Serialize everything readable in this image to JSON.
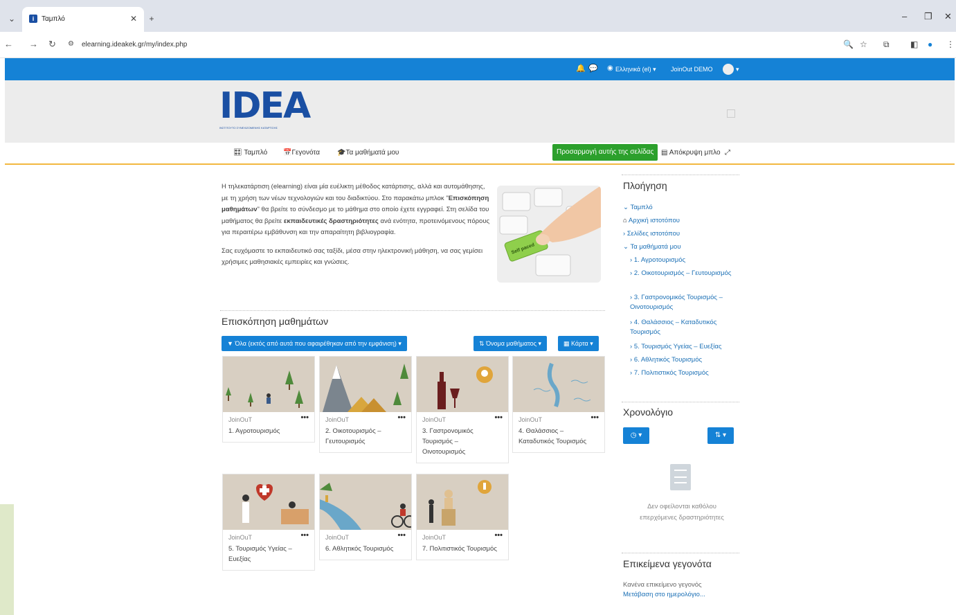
{
  "browser": {
    "tab_title": "Ταμπλό",
    "url": "elearning.ideakek.gr/my/index.php"
  },
  "topnav": {
    "language": "Ελληνικά (el) ▾",
    "user": "JoinOut DEMO"
  },
  "logo": {
    "text": "IDEA",
    "subtitle": "ΙΝΣΤΙΤΟΥΤΟ ΣΥΝΕΧΙΖΟΜΕΝΗΣ ΚΑΤΑΡΤΙΣΗΣ"
  },
  "secnav": {
    "dashboard": "Ταμπλό",
    "events": "Γεγονότα",
    "my_courses": "Τα μαθήματά μου",
    "customize": "Προσαρμογή αυτής της σελίδας",
    "hide_blocks": "Απόκρυψη μπλο"
  },
  "intro": {
    "p1_a": "Η τηλεκατάρτιση (elearning) είναι μία ευέλικτη μέθοδος κατάρτισης, αλλά και αυτομάθησης, με τη χρήση των νέων τεχνολογιών και του διαδικτύου. Στο παρακάτω μπλοκ \"",
    "p1_b": "Επισκόπηση μαθημάτων",
    "p1_c": "\" θα βρείτε το σύνδεσμο με το μάθημα στο οποίο έχετε εγγραφεί. Στη σελίδα του μαθήματος θα βρείτε ",
    "p1_d": "εκπαιδευτικές δραστηριότητες",
    "p1_e": " ανά ενότητα, προτεινόμενους πόρους για περαιτέρω εμβάθυνση και την απαραίτητη βιβλιογραφία.",
    "p2": "Σας ευχόμαστε το εκπαιδευτικό σας ταξίδι, μέσα στην ηλεκτρονική μάθηση, να σας γεμίσει χρήσιμες μαθησιακές εμπειρίες και γνώσεις.",
    "hero_key": "Self paced"
  },
  "overview": {
    "title": "Επισκόπηση μαθημάτων",
    "filter": "Όλα (εκτός από αυτά που αφαιρέθηκαν από την εμφάνιση) ▾",
    "sort": "Όνομα μαθήματος ▾",
    "view": "Κάρτα ▾",
    "courses": [
      {
        "org": "JoinOuT",
        "name": "1. Αγροτουρισμός"
      },
      {
        "org": "JoinOuT",
        "name": "2. Οικοτουρισμός – Γευτουρισμός"
      },
      {
        "org": "JoinOuT",
        "name": "3. Γαστρονομικός Τουρισμός – Οινοτουρισμός"
      },
      {
        "org": "JoinOuT",
        "name": "4. Θαλάσσιος – Καταδυτικός Τουρισμός"
      },
      {
        "org": "JoinOuT",
        "name": "5. Τουρισμός Υγείας – Ευεξίας"
      },
      {
        "org": "JoinOuT",
        "name": "6. Αθλητικός Τουρισμός"
      },
      {
        "org": "JoinOuT",
        "name": "7. Πολιτιστικός Τουρισμός"
      }
    ]
  },
  "navigation": {
    "title": "Πλοήγηση",
    "dashboard": "Ταμπλό",
    "home": "Αρχική ιστοτόπου",
    "site_pages": "Σελίδες ιστοτόπου",
    "my_courses": "Τα μαθήματά μου",
    "courses": [
      "1. Αγροτουρισμός",
      "2. Οικοτουρισμός – Γευτουρισμός",
      "3. Γαστρονομικός Τουρισμός – Οινοτουρισμός",
      "4. Θαλάσσιος – Καταδυτικός Τουρισμός",
      "5. Τουρισμός Υγείας – Ευεξίας",
      "6. Αθλητικός Τουρισμός",
      "7. Πολιτιστικός Τουρισμός"
    ]
  },
  "timeline": {
    "title": "Χρονολόγιο",
    "empty": "Δεν οφείλονται καθόλου επερχόμενες δραστηριότητες"
  },
  "upcoming": {
    "title": "Επικείμενα γεγονότα",
    "none": "Κανένα επικείμενο γεγονός",
    "calendar_link": "Μετάβαση στο ημερολόγιο..."
  },
  "colors": {
    "primary": "#1582d6",
    "success": "#2ca02c",
    "accent_line": "#f2b840",
    "logo": "#1a4fa3"
  }
}
